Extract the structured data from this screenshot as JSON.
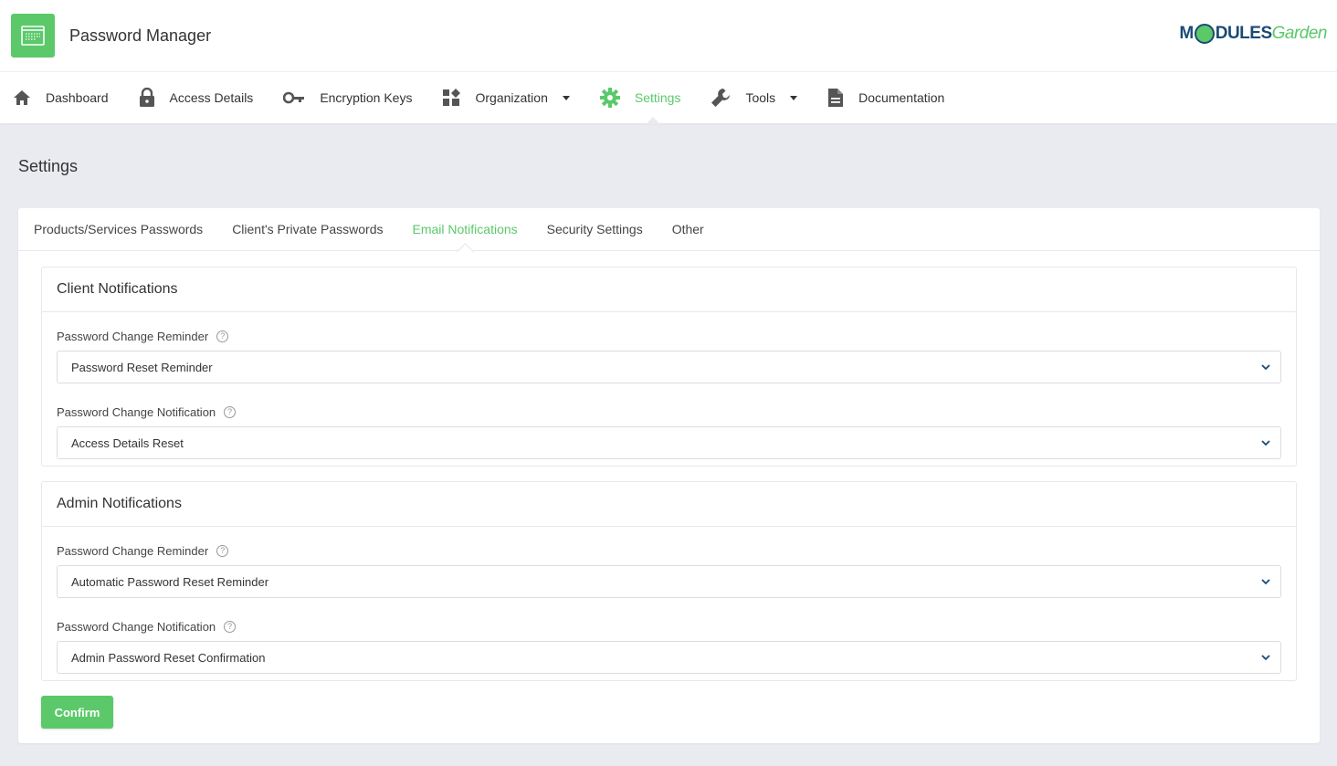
{
  "app": {
    "title": "Password Manager",
    "logo_part1": "M",
    "logo_part2": "DULES",
    "logo_part3": "Garden"
  },
  "nav": {
    "items": [
      {
        "label": "Dashboard",
        "icon": "home-icon"
      },
      {
        "label": "Access Details",
        "icon": "lock-icon"
      },
      {
        "label": "Encryption Keys",
        "icon": "key-icon"
      },
      {
        "label": "Organization",
        "icon": "widgets-icon",
        "dropdown": true
      },
      {
        "label": "Settings",
        "icon": "gear-icon",
        "active": true
      },
      {
        "label": "Tools",
        "icon": "wrench-icon",
        "dropdown": true
      },
      {
        "label": "Documentation",
        "icon": "document-icon"
      }
    ]
  },
  "page": {
    "title": "Settings"
  },
  "tabs": [
    {
      "label": "Products/Services Passwords"
    },
    {
      "label": "Client's Private Passwords"
    },
    {
      "label": "Email Notifications",
      "active": true
    },
    {
      "label": "Security Settings"
    },
    {
      "label": "Other"
    }
  ],
  "client_notifications": {
    "title": "Client Notifications",
    "reminder_label": "Password Change Reminder",
    "reminder_value": "Password Reset Reminder",
    "notification_label": "Password Change Notification",
    "notification_value": "Access Details Reset"
  },
  "admin_notifications": {
    "title": "Admin Notifications",
    "reminder_label": "Password Change Reminder",
    "reminder_value": "Automatic Password Reset Reminder",
    "notification_label": "Password Change Notification",
    "notification_value": "Admin Password Reset Confirmation"
  },
  "help_glyph": "?",
  "confirm_label": "Confirm",
  "colors": {
    "accent": "#5bc96a",
    "brand_dark": "#1b4a74",
    "background": "#eaebf0"
  }
}
